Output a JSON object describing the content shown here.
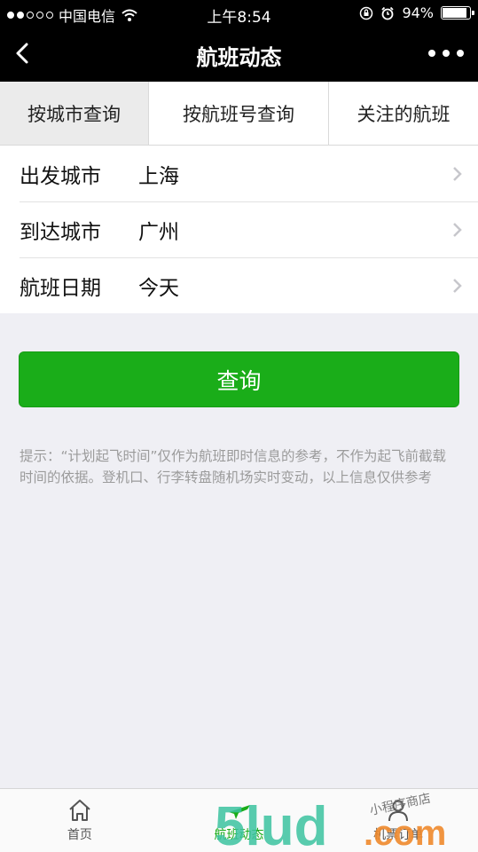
{
  "status_bar": {
    "carrier": "中国电信",
    "time": "上午8:54",
    "battery": "94%",
    "battery_level": 0.94
  },
  "nav": {
    "title": "航班动态"
  },
  "tabs": [
    {
      "label": "按城市查询",
      "active": true
    },
    {
      "label": "按航班号查询",
      "active": false
    },
    {
      "label": "关注的航班",
      "active": false
    }
  ],
  "form": {
    "rows": [
      {
        "label": "出发城市",
        "value": "上海"
      },
      {
        "label": "到达城市",
        "value": "广州"
      },
      {
        "label": "航班日期",
        "value": "今天"
      }
    ]
  },
  "query_button": "查询",
  "tip": "提示：“计划起飞时间”仅作为航班即时信息的参考，不作为起飞前截载时间的依据。登机口、行李转盘随机场实时变动，以上信息仅供参考",
  "tab_bar": {
    "items": [
      {
        "label": "首页",
        "icon": "home-icon",
        "active": false
      },
      {
        "label": "航班动态",
        "icon": "plane-icon",
        "active": true
      },
      {
        "label": "机票订单",
        "icon": "user-icon",
        "active": false
      }
    ]
  },
  "watermark": {
    "text": "5lud.com",
    "subtext": "小程序商店"
  },
  "colors": {
    "accent": "#1aad19",
    "nav_bg": "#000000",
    "page_bg": "#efeff4"
  }
}
